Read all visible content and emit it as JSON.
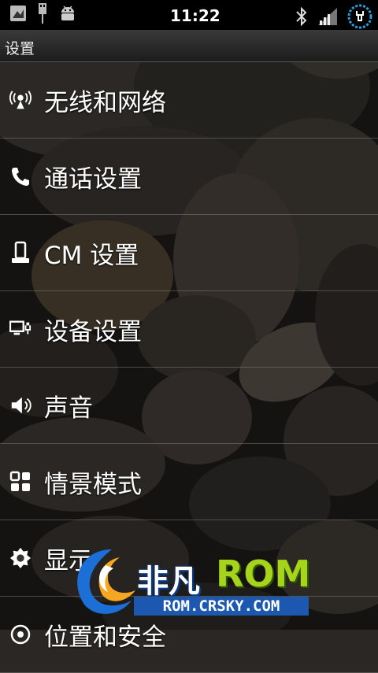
{
  "status_bar": {
    "time": "11:22",
    "icons": [
      "image-icon",
      "usb-icon",
      "android-debug-icon",
      "bluetooth-icon",
      "signal-icon",
      "battery-charging-icon"
    ]
  },
  "title": "设置",
  "items": [
    {
      "label": "无线和网络",
      "icon": "wireless-icon"
    },
    {
      "label": "通话设置",
      "icon": "phone-icon"
    },
    {
      "label": "CM 设置",
      "icon": "device-icon"
    },
    {
      "label": "设备设置",
      "icon": "monitor-plug-icon"
    },
    {
      "label": "声音",
      "icon": "speaker-icon"
    },
    {
      "label": "情景模式",
      "icon": "grid-icon"
    },
    {
      "label": "显示",
      "icon": "brightness-icon"
    },
    {
      "label": "位置和安全",
      "icon": "location-icon"
    }
  ],
  "watermark": {
    "brand_cn": "非凡",
    "brand_en": "ROM",
    "url": "ROM.CRSKY.COM"
  }
}
